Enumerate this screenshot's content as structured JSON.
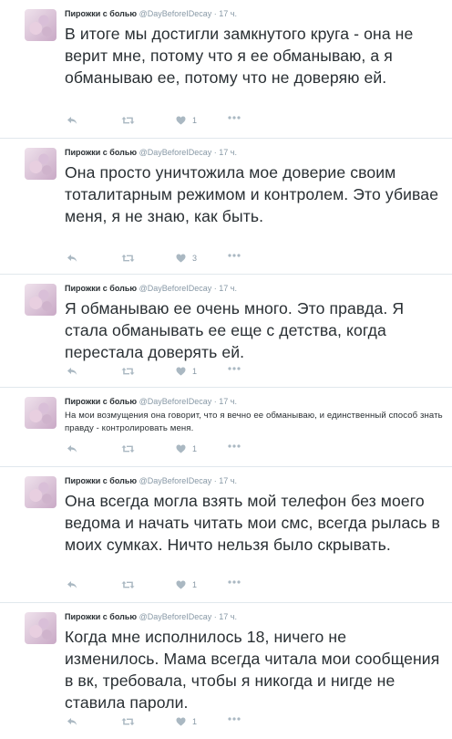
{
  "colors": {
    "text": "#292f33",
    "muted": "#8899a6",
    "icon": "#aab8c2",
    "divider": "#e1e8ed"
  },
  "icons": {
    "reply": "reply-icon",
    "retweet": "retweet-icon",
    "like": "heart-icon",
    "more": "more-icon"
  },
  "tweets": [
    {
      "author": "Пирожки с болью",
      "handle": "@DayBeforeIDecay",
      "sep": "·",
      "time": "17 ч.",
      "text": "В итоге мы достигли замкнутого круга - она не верит мне, потому что я ее обманываю, а я обманываю ее, потому что не доверяю ей.",
      "likes": "1"
    },
    {
      "author": "Пирожки с болью",
      "handle": "@DayBeforeIDecay",
      "sep": "·",
      "time": "17 ч.",
      "text": "Она просто уничтожила мое доверие своим тоталитарным режимом и контролем. Это убивае меня, я не знаю, как быть.",
      "likes": "3"
    },
    {
      "author": "Пирожки с болью",
      "handle": "@DayBeforeIDecay",
      "sep": "·",
      "time": "17 ч.",
      "text": "Я обманываю ее очень много. Это правда. Я стала обманывать ее еще с детства, когда перестала доверять ей.",
      "likes": "1"
    },
    {
      "author": "Пирожки с болью",
      "handle": "@DayBeforeIDecay",
      "sep": "·",
      "time": "17 ч.",
      "text": "На мои возмущения она говорит, что я вечно ее обманываю, и единственный способ знать правду - контролировать меня.",
      "likes": "1"
    },
    {
      "author": "Пирожки с болью",
      "handle": "@DayBeforeIDecay",
      "sep": "·",
      "time": "17 ч.",
      "text": "Она всегда могла взять мой телефон без моего ведома и начать читать мои смс, всегда рылась в моих сумках. Ничто нельзя было скрывать.",
      "likes": "1"
    },
    {
      "author": "Пирожки с болью",
      "handle": "@DayBeforeIDecay",
      "sep": "·",
      "time": "17 ч.",
      "text": "Когда мне исполнилось 18, ничего не изменилось. Мама всегда читала мои сообщения в вк, требовала, чтобы я никогда и нигде не ставила пароли.",
      "likes": "1"
    }
  ]
}
